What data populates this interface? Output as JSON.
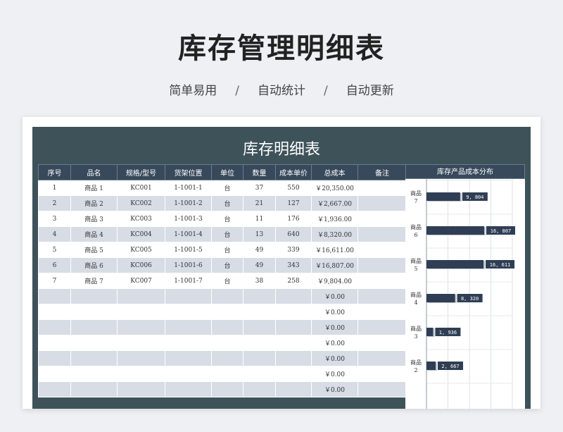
{
  "header": {
    "title": "库存管理明细表",
    "features": [
      "简单易用",
      "自动统计",
      "自动更新"
    ],
    "separator": "/"
  },
  "sheet": {
    "title": "库存明细表",
    "columns": [
      "序号",
      "品名",
      "规格/型号",
      "货架位置",
      "单位",
      "数量",
      "成本单价",
      "总成本",
      "备注"
    ],
    "rows": [
      [
        "1",
        "商品 1",
        "KC001",
        "1-1001-1",
        "台",
        "37",
        "550",
        "￥20,350.00",
        ""
      ],
      [
        "2",
        "商品 2",
        "KC002",
        "1-1001-2",
        "台",
        "21",
        "127",
        "￥2,667.00",
        ""
      ],
      [
        "3",
        "商品 3",
        "KC003",
        "1-1001-3",
        "台",
        "11",
        "176",
        "￥1,936.00",
        ""
      ],
      [
        "4",
        "商品 4",
        "KC004",
        "1-1001-4",
        "台",
        "13",
        "640",
        "￥8,320.00",
        ""
      ],
      [
        "5",
        "商品 5",
        "KC005",
        "1-1001-5",
        "台",
        "49",
        "339",
        "￥16,611.00",
        ""
      ],
      [
        "6",
        "商品 6",
        "KC006",
        "1-1001-6",
        "台",
        "49",
        "343",
        "￥16,807.00",
        ""
      ],
      [
        "7",
        "商品 7",
        "KC007",
        "1-1001-7",
        "台",
        "38",
        "258",
        "￥9,804.00",
        ""
      ],
      [
        "",
        "",
        "",
        "",
        "",
        "",
        "",
        "￥0.00",
        ""
      ],
      [
        "",
        "",
        "",
        "",
        "",
        "",
        "",
        "￥0.00",
        ""
      ],
      [
        "",
        "",
        "",
        "",
        "",
        "",
        "",
        "￥0.00",
        ""
      ],
      [
        "",
        "",
        "",
        "",
        "",
        "",
        "",
        "￥0.00",
        ""
      ],
      [
        "",
        "",
        "",
        "",
        "",
        "",
        "",
        "￥0.00",
        ""
      ],
      [
        "",
        "",
        "",
        "",
        "",
        "",
        "",
        "￥0.00",
        ""
      ],
      [
        "",
        "",
        "",
        "",
        "",
        "",
        "",
        "￥0.00",
        ""
      ]
    ]
  },
  "chart_data": {
    "type": "bar",
    "orientation": "horizontal",
    "title": "库存产品成本分布",
    "categories": [
      "商品 7",
      "商品 6",
      "商品 5",
      "商品 4",
      "商品 3",
      "商品 2"
    ],
    "values": [
      9804,
      16807,
      16611,
      8320,
      1936,
      2667
    ],
    "value_labels": [
      "9, 804",
      "16, 807",
      "16, 611",
      "8, 320",
      "1, 936",
      "2, 667"
    ],
    "xlim": [
      0,
      25000
    ],
    "grid": true,
    "bar_color": "#2f3e54"
  }
}
